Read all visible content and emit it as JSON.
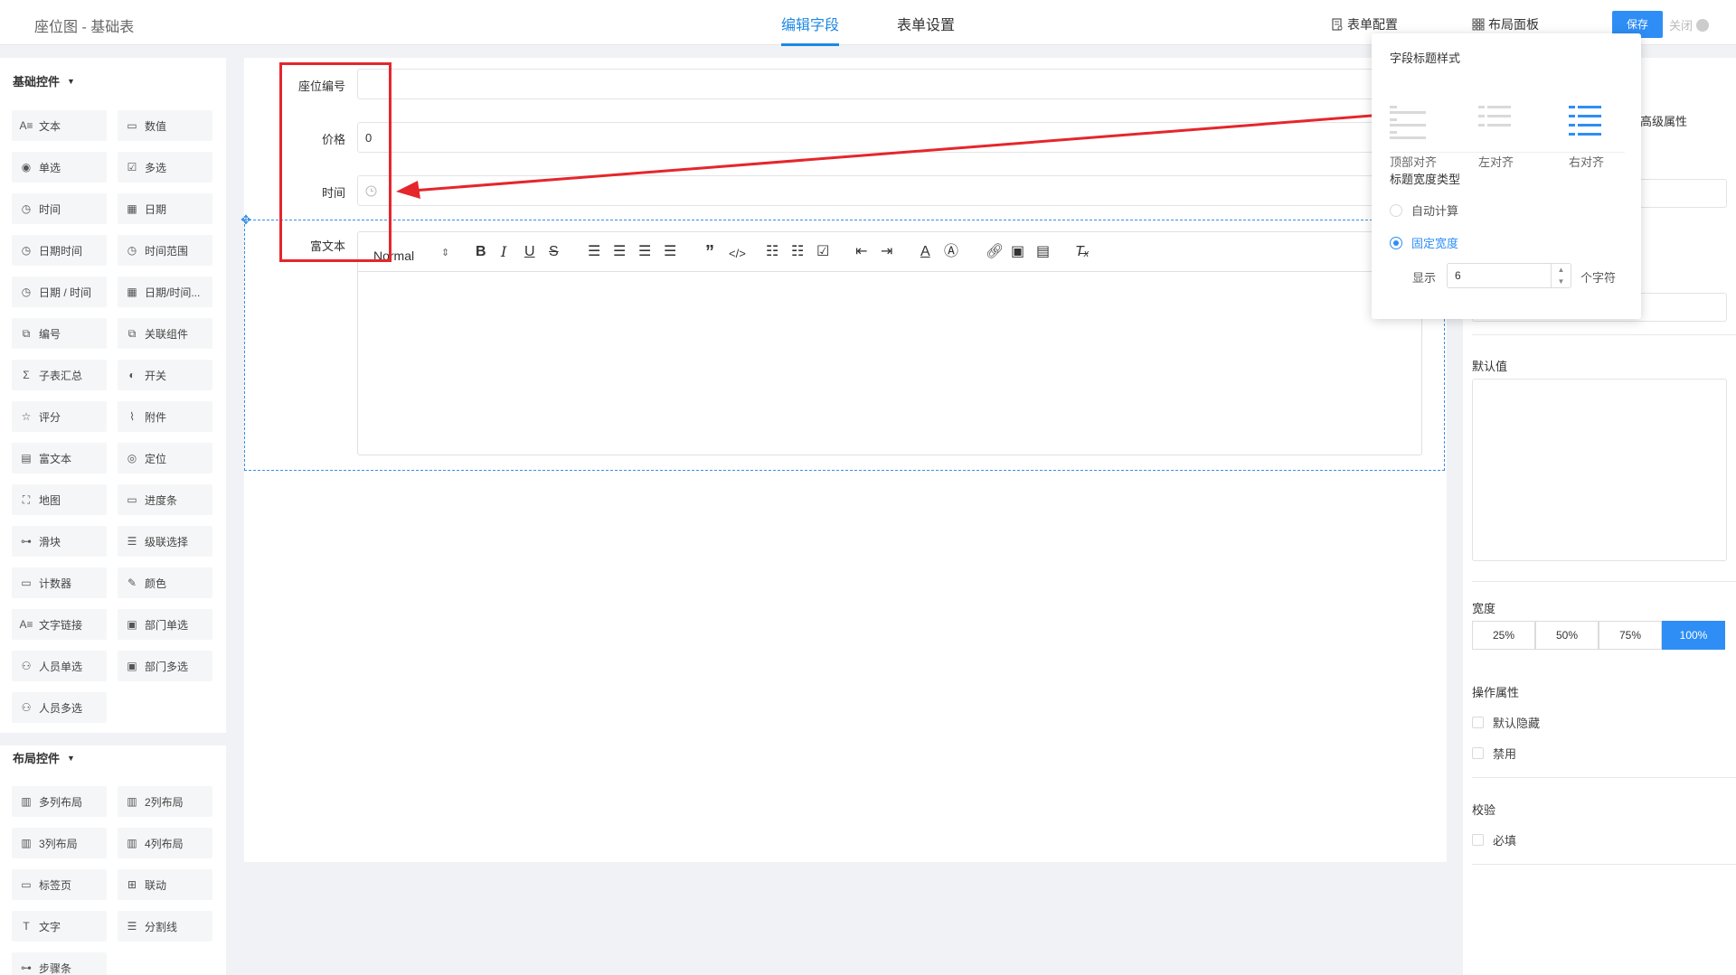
{
  "app": {
    "title": "座位图 - 基础表"
  },
  "tabs": [
    {
      "label": "编辑字段"
    },
    {
      "label": "表单设置"
    }
  ],
  "top_actions": {
    "form_config": "表单配置",
    "layout_panel": "布局面板",
    "save": "保存",
    "close": "关闭"
  },
  "left": {
    "basic_title": "基础控件",
    "basic": [
      {
        "label": "文本",
        "icon": "text-icon"
      },
      {
        "label": "数值",
        "icon": "number-icon"
      },
      {
        "label": "单选",
        "icon": "radio-icon"
      },
      {
        "label": "多选",
        "icon": "checkbox-icon"
      },
      {
        "label": "时间",
        "icon": "clock-icon"
      },
      {
        "label": "日期",
        "icon": "calendar-icon"
      },
      {
        "label": "日期时间",
        "icon": "clock-icon"
      },
      {
        "label": "时间范围",
        "icon": "clock-icon"
      },
      {
        "label": "日期 / 时间",
        "icon": "clock-icon"
      },
      {
        "label": "日期/时间...",
        "icon": "calendar-icon"
      },
      {
        "label": "编号",
        "icon": "serial-icon"
      },
      {
        "label": "关联组件",
        "icon": "link-component-icon"
      },
      {
        "label": "子表汇总",
        "icon": "sigma-icon"
      },
      {
        "label": "开关",
        "icon": "toggle-icon"
      },
      {
        "label": "评分",
        "icon": "star-icon"
      },
      {
        "label": "附件",
        "icon": "paperclip-icon"
      },
      {
        "label": "富文本",
        "icon": "richtext-icon"
      },
      {
        "label": "定位",
        "icon": "location-icon"
      },
      {
        "label": "地图",
        "icon": "map-icon"
      },
      {
        "label": "进度条",
        "icon": "progress-icon"
      },
      {
        "label": "滑块",
        "icon": "slider-icon"
      },
      {
        "label": "级联选择",
        "icon": "cascade-icon"
      },
      {
        "label": "计数器",
        "icon": "counter-icon"
      },
      {
        "label": "颜色",
        "icon": "color-picker-icon"
      },
      {
        "label": "文字链接",
        "icon": "text-link-icon"
      },
      {
        "label": "部门单选",
        "icon": "department-icon"
      },
      {
        "label": "人员单选",
        "icon": "user-icon"
      },
      {
        "label": "部门多选",
        "icon": "department-icon"
      },
      {
        "label": "人员多选",
        "icon": "users-icon"
      }
    ],
    "layout_title": "布局控件",
    "layout": [
      {
        "label": "多列布局",
        "icon": "columns-icon"
      },
      {
        "label": "2列布局",
        "icon": "columns-icon"
      },
      {
        "label": "3列布局",
        "icon": "columns-icon"
      },
      {
        "label": "4列布局",
        "icon": "columns-icon"
      },
      {
        "label": "标签页",
        "icon": "tabs-icon"
      },
      {
        "label": "联动",
        "icon": "grid-icon"
      },
      {
        "label": "文字",
        "icon": "type-icon"
      },
      {
        "label": "分割线",
        "icon": "divider-icon"
      },
      {
        "label": "步骤条",
        "icon": "steps-icon"
      }
    ]
  },
  "form": {
    "fields": [
      {
        "label": "座位编号",
        "value": ""
      },
      {
        "label": "价格",
        "value": "0"
      },
      {
        "label": "时间",
        "value": ""
      },
      {
        "label": "富文本",
        "value": ""
      }
    ],
    "rte_font": "Normal"
  },
  "popover": {
    "title_style": "字段标题样式",
    "options": [
      "顶部对齐",
      "左对齐",
      "右对齐"
    ],
    "selected_option": "右对齐",
    "width_type_title": "标题宽度类型",
    "auto_calc": "自动计算",
    "fixed_width": "固定宽度",
    "display_label": "显示",
    "display_value": "6",
    "unit": "个字符"
  },
  "right": {
    "advanced_tab": "高级属性",
    "default_value_label": "默认值",
    "width_label": "宽度",
    "width_options": [
      "25%",
      "50%",
      "75%",
      "100%"
    ],
    "width_selected": "100%",
    "ops_label": "操作属性",
    "hide_default": "默认隐藏",
    "disabled": "禁用",
    "validation_label": "校验",
    "required": "必填"
  },
  "colors": {
    "accent": "#2e8ef5",
    "annotation": "#e5262b"
  }
}
